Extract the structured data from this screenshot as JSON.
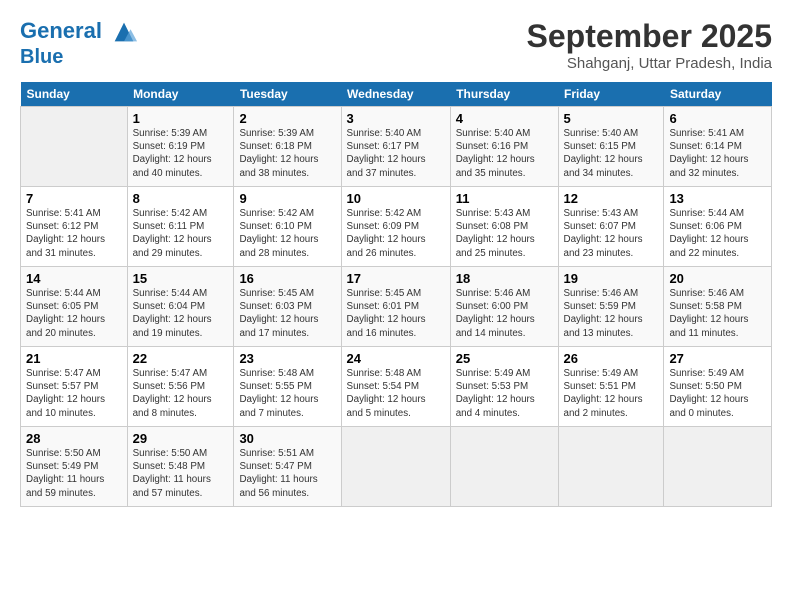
{
  "header": {
    "logo_line1": "General",
    "logo_line2": "Blue",
    "month": "September 2025",
    "location": "Shahganj, Uttar Pradesh, India"
  },
  "days_of_week": [
    "Sunday",
    "Monday",
    "Tuesday",
    "Wednesday",
    "Thursday",
    "Friday",
    "Saturday"
  ],
  "weeks": [
    [
      {
        "num": "",
        "info": ""
      },
      {
        "num": "1",
        "info": "Sunrise: 5:39 AM\nSunset: 6:19 PM\nDaylight: 12 hours\nand 40 minutes."
      },
      {
        "num": "2",
        "info": "Sunrise: 5:39 AM\nSunset: 6:18 PM\nDaylight: 12 hours\nand 38 minutes."
      },
      {
        "num": "3",
        "info": "Sunrise: 5:40 AM\nSunset: 6:17 PM\nDaylight: 12 hours\nand 37 minutes."
      },
      {
        "num": "4",
        "info": "Sunrise: 5:40 AM\nSunset: 6:16 PM\nDaylight: 12 hours\nand 35 minutes."
      },
      {
        "num": "5",
        "info": "Sunrise: 5:40 AM\nSunset: 6:15 PM\nDaylight: 12 hours\nand 34 minutes."
      },
      {
        "num": "6",
        "info": "Sunrise: 5:41 AM\nSunset: 6:14 PM\nDaylight: 12 hours\nand 32 minutes."
      }
    ],
    [
      {
        "num": "7",
        "info": "Sunrise: 5:41 AM\nSunset: 6:12 PM\nDaylight: 12 hours\nand 31 minutes."
      },
      {
        "num": "8",
        "info": "Sunrise: 5:42 AM\nSunset: 6:11 PM\nDaylight: 12 hours\nand 29 minutes."
      },
      {
        "num": "9",
        "info": "Sunrise: 5:42 AM\nSunset: 6:10 PM\nDaylight: 12 hours\nand 28 minutes."
      },
      {
        "num": "10",
        "info": "Sunrise: 5:42 AM\nSunset: 6:09 PM\nDaylight: 12 hours\nand 26 minutes."
      },
      {
        "num": "11",
        "info": "Sunrise: 5:43 AM\nSunset: 6:08 PM\nDaylight: 12 hours\nand 25 minutes."
      },
      {
        "num": "12",
        "info": "Sunrise: 5:43 AM\nSunset: 6:07 PM\nDaylight: 12 hours\nand 23 minutes."
      },
      {
        "num": "13",
        "info": "Sunrise: 5:44 AM\nSunset: 6:06 PM\nDaylight: 12 hours\nand 22 minutes."
      }
    ],
    [
      {
        "num": "14",
        "info": "Sunrise: 5:44 AM\nSunset: 6:05 PM\nDaylight: 12 hours\nand 20 minutes."
      },
      {
        "num": "15",
        "info": "Sunrise: 5:44 AM\nSunset: 6:04 PM\nDaylight: 12 hours\nand 19 minutes."
      },
      {
        "num": "16",
        "info": "Sunrise: 5:45 AM\nSunset: 6:03 PM\nDaylight: 12 hours\nand 17 minutes."
      },
      {
        "num": "17",
        "info": "Sunrise: 5:45 AM\nSunset: 6:01 PM\nDaylight: 12 hours\nand 16 minutes."
      },
      {
        "num": "18",
        "info": "Sunrise: 5:46 AM\nSunset: 6:00 PM\nDaylight: 12 hours\nand 14 minutes."
      },
      {
        "num": "19",
        "info": "Sunrise: 5:46 AM\nSunset: 5:59 PM\nDaylight: 12 hours\nand 13 minutes."
      },
      {
        "num": "20",
        "info": "Sunrise: 5:46 AM\nSunset: 5:58 PM\nDaylight: 12 hours\nand 11 minutes."
      }
    ],
    [
      {
        "num": "21",
        "info": "Sunrise: 5:47 AM\nSunset: 5:57 PM\nDaylight: 12 hours\nand 10 minutes."
      },
      {
        "num": "22",
        "info": "Sunrise: 5:47 AM\nSunset: 5:56 PM\nDaylight: 12 hours\nand 8 minutes."
      },
      {
        "num": "23",
        "info": "Sunrise: 5:48 AM\nSunset: 5:55 PM\nDaylight: 12 hours\nand 7 minutes."
      },
      {
        "num": "24",
        "info": "Sunrise: 5:48 AM\nSunset: 5:54 PM\nDaylight: 12 hours\nand 5 minutes."
      },
      {
        "num": "25",
        "info": "Sunrise: 5:49 AM\nSunset: 5:53 PM\nDaylight: 12 hours\nand 4 minutes."
      },
      {
        "num": "26",
        "info": "Sunrise: 5:49 AM\nSunset: 5:51 PM\nDaylight: 12 hours\nand 2 minutes."
      },
      {
        "num": "27",
        "info": "Sunrise: 5:49 AM\nSunset: 5:50 PM\nDaylight: 12 hours\nand 0 minutes."
      }
    ],
    [
      {
        "num": "28",
        "info": "Sunrise: 5:50 AM\nSunset: 5:49 PM\nDaylight: 11 hours\nand 59 minutes."
      },
      {
        "num": "29",
        "info": "Sunrise: 5:50 AM\nSunset: 5:48 PM\nDaylight: 11 hours\nand 57 minutes."
      },
      {
        "num": "30",
        "info": "Sunrise: 5:51 AM\nSunset: 5:47 PM\nDaylight: 11 hours\nand 56 minutes."
      },
      {
        "num": "",
        "info": ""
      },
      {
        "num": "",
        "info": ""
      },
      {
        "num": "",
        "info": ""
      },
      {
        "num": "",
        "info": ""
      }
    ]
  ]
}
